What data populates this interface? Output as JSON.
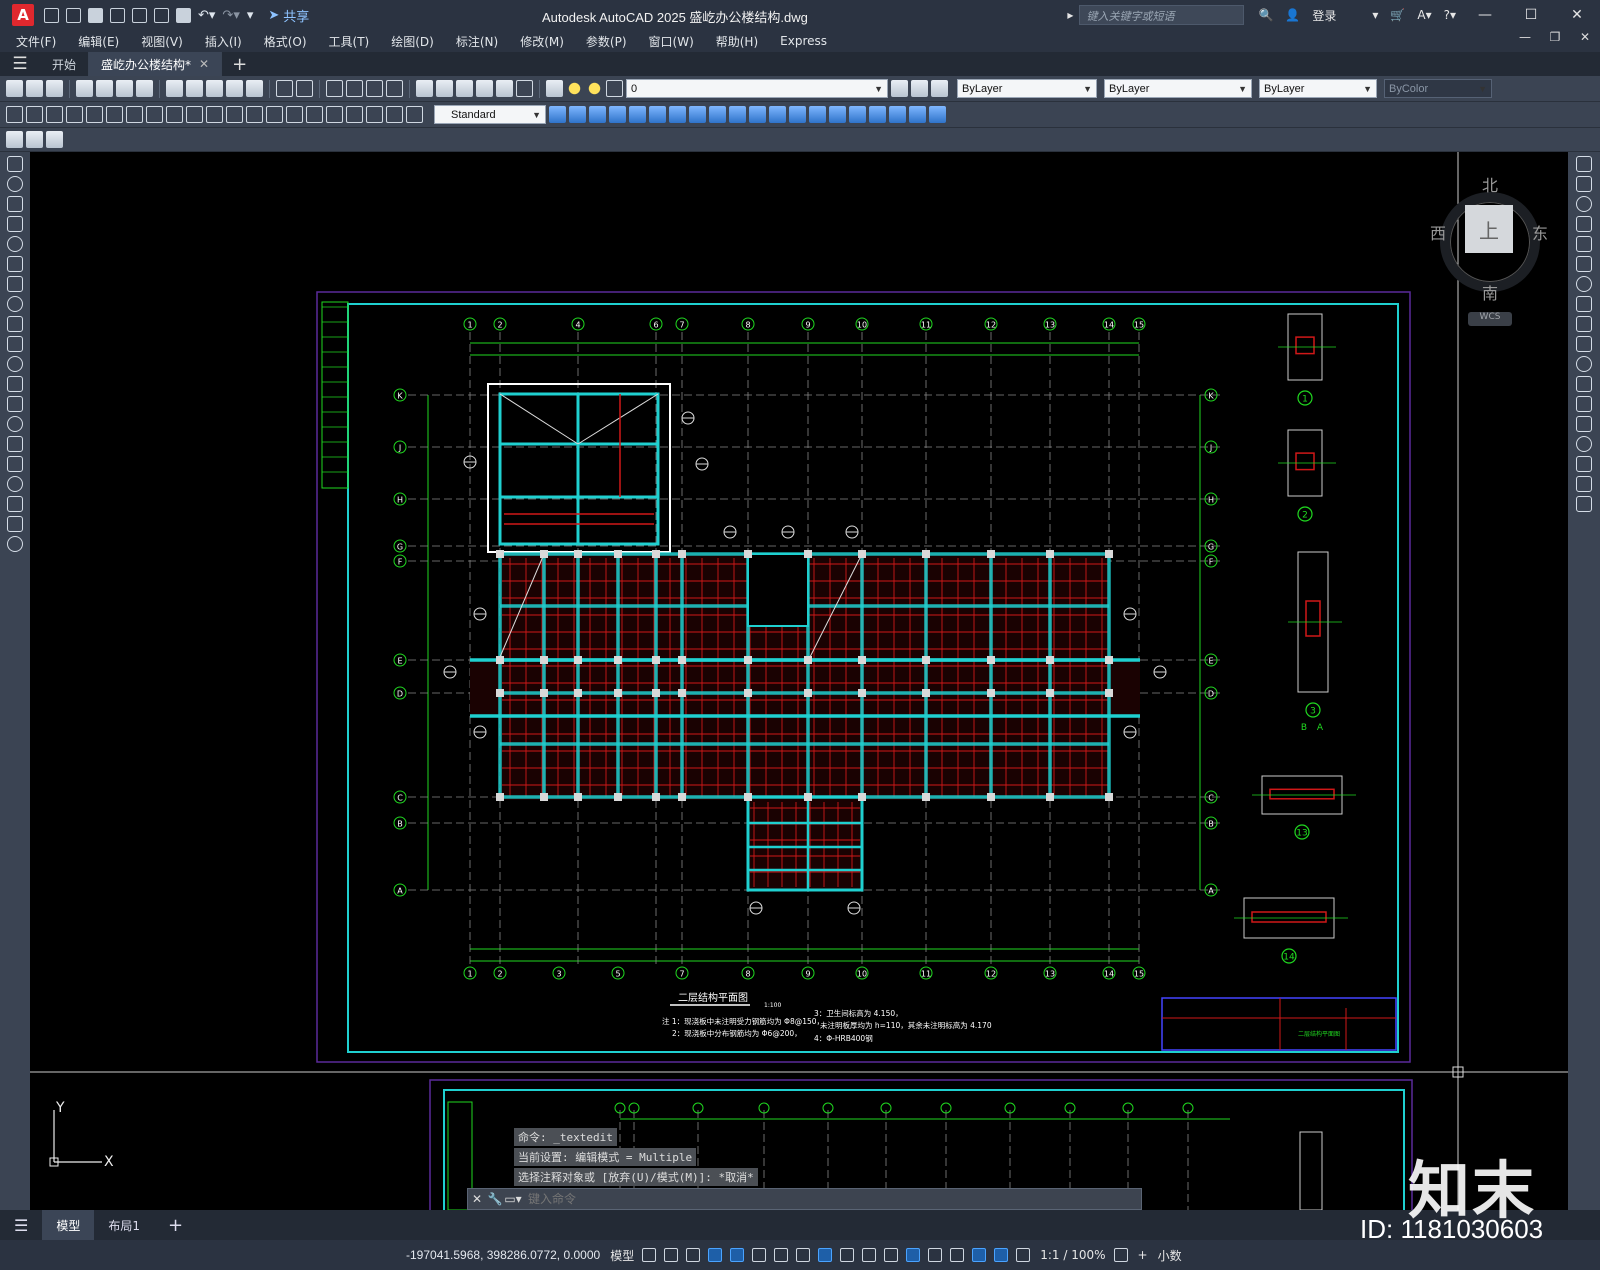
{
  "titlebar": {
    "app_letter": "A",
    "share_label": "共享",
    "title": "Autodesk AutoCAD 2025    盛屹办公楼结构.dwg",
    "search_placeholder": "键入关键字或短语",
    "login_label": "登录"
  },
  "menu": [
    "文件(F)",
    "编辑(E)",
    "视图(V)",
    "插入(I)",
    "格式(O)",
    "工具(T)",
    "绘图(D)",
    "标注(N)",
    "修改(M)",
    "参数(P)",
    "窗口(W)",
    "帮助(H)",
    "Express"
  ],
  "tabs": {
    "start": "开始",
    "active": "盛屹办公楼结构*"
  },
  "toolbar": {
    "layer_value": "0",
    "color_value": "ByLayer",
    "linetype_value": "ByLayer",
    "lineweight_value": "ByLayer",
    "plotstyle_value": "ByColor",
    "textstyle_value": "Standard"
  },
  "viewcube": {
    "north": "北",
    "south": "南",
    "east": "东",
    "west": "西",
    "face": "上",
    "wcs": "WCS"
  },
  "drawing": {
    "title": "二层结构平面图",
    "scale": "1:100",
    "note1": "注 1：现浇板中未注明受力钢筋均为 Φ8@150，",
    "note2": "2：现浇板中分布钢筋均为 Φ6@200，",
    "note3": "3：卫生间标高为 4.150，",
    "note4": "未注明板厚均为 h=110，其余未注明标高为 4.170",
    "note5": "4：Φ-HRB400钢",
    "axis_top": [
      "1",
      "2",
      "4",
      "6",
      "7",
      "8",
      "9",
      "10",
      "11",
      "12",
      "13",
      "14",
      "15"
    ],
    "axis_bottom": [
      "1",
      "2",
      "3",
      "5",
      "7",
      "8",
      "9",
      "10",
      "11",
      "12",
      "13",
      "14",
      "15"
    ],
    "axis_rows": [
      "K",
      "J",
      "H",
      "G",
      "F",
      "E",
      "D",
      "C",
      "B",
      "A"
    ],
    "detail_labels": [
      "1",
      "2",
      "3",
      "13",
      "14"
    ],
    "detail_axes": [
      "B",
      "A"
    ],
    "title_block": "二层结构平面图"
  },
  "command": {
    "hist1": "命令: _textedit",
    "hist2": "当前设置: 编辑模式 = Multiple",
    "hist3": "选择注释对象或 [放弃(U)/模式(M)]: *取消*",
    "placeholder": "键入命令"
  },
  "layouts": {
    "model": "模型",
    "layout1": "布局1"
  },
  "status": {
    "coords": "-197041.5968, 398286.0772, 0.0000",
    "model": "模型",
    "scale": "1:1 / 100%",
    "units": "小数"
  },
  "watermark": {
    "logo": "知末",
    "id": "ID: 1181030603"
  },
  "colors": {
    "titlebar": "#2b3341",
    "toolbar": "#3b4453",
    "cyan": "#1fd0d0",
    "green": "#20d820",
    "red": "#d01818",
    "purple": "#5a2a9a"
  }
}
